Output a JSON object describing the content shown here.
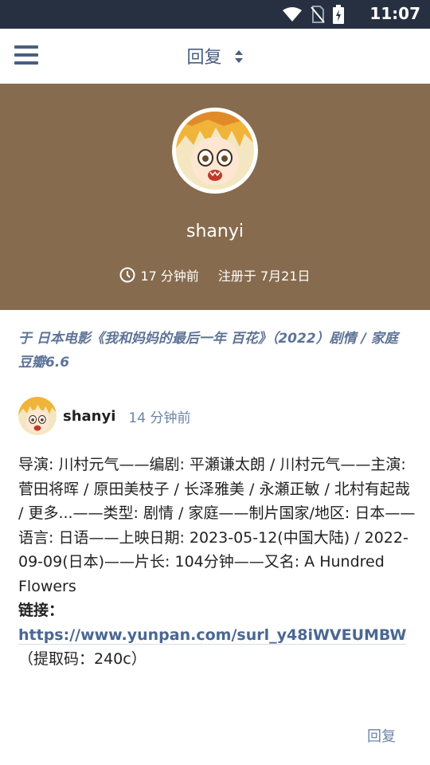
{
  "status_bar": {
    "time": "11:07",
    "icons": [
      "wifi-icon",
      "no-sim-icon",
      "battery-icon"
    ]
  },
  "app_bar": {
    "title": "回复",
    "menu_icon": "hamburger-menu-icon",
    "sort_icon": "sort-updown-icon"
  },
  "profile": {
    "username": "shanyi",
    "last_seen": "17 分钟前",
    "registered": "注册于 7月21日",
    "background_color": "#876b4e"
  },
  "topic": {
    "prefix": "于",
    "title": "日本电影《我和妈妈的最后一年 百花》（2022）剧情 / 家庭 豆瓣6.6"
  },
  "post": {
    "author": "shanyi",
    "time_ago": "14 分钟前",
    "body": "导演: 川村元气——编剧: 平瀬谦太朗 / 川村元气——主演: 菅田将晖 / 原田美枝子 / 长泽雅美 / 永瀬正敏 / 北村有起哉 / 更多...——类型: 剧情 / 家庭——制片国家/地区: 日本——语言: 日语——上映日期: 2023-05-12(中国大陆) / 2022-09-09(日本)——片长: 104分钟——又名: A Hundred Flowers",
    "link_label": "链接：",
    "link_url": "https://www.yunpan.com/surl_y48iWVEUMBW",
    "link_suffix": "（提取码：240c）",
    "reply_label": "回复"
  },
  "colors": {
    "status_bar": "#273041",
    "accent": "#4a5f7e",
    "link": "#4a6793",
    "muted": "#6b84a6"
  }
}
